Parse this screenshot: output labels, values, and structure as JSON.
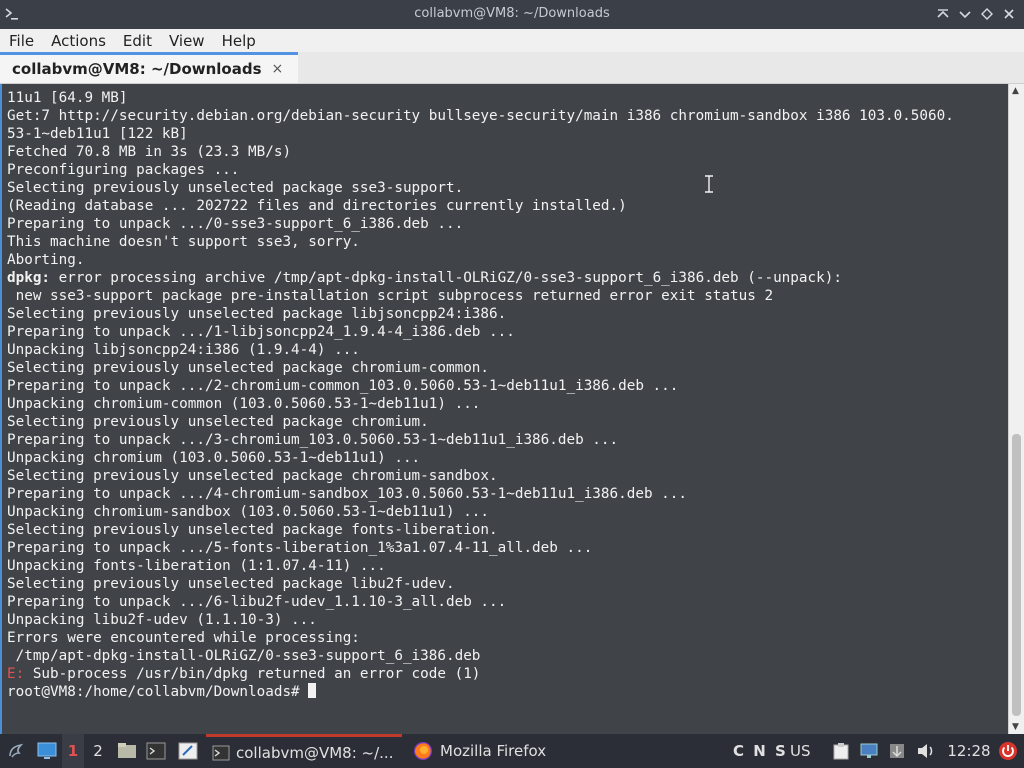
{
  "window": {
    "title": "collabvm@VM8: ~/Downloads",
    "controls": [
      "maximize-icon",
      "minimize-icon",
      "sticky-icon",
      "close-icon"
    ]
  },
  "menu": [
    "File",
    "Actions",
    "Edit",
    "View",
    "Help"
  ],
  "tab": {
    "label": "collabvm@VM8: ~/Downloads",
    "close": "×"
  },
  "terminal": {
    "lines": [
      {
        "t": "11u1 [64.9 MB]"
      },
      {
        "t": "Get:7 http://security.debian.org/debian-security bullseye-security/main i386 chromium-sandbox i386 103.0.5060."
      },
      {
        "t": "53-1~deb11u1 [122 kB]"
      },
      {
        "t": "Fetched 70.8 MB in 3s (23.3 MB/s)"
      },
      {
        "t": "Preconfiguring packages ..."
      },
      {
        "t": "Selecting previously unselected package sse3-support."
      },
      {
        "t": "(Reading database ... 202722 files and directories currently installed.)"
      },
      {
        "t": "Preparing to unpack .../0-sse3-support_6_i386.deb ..."
      },
      {
        "t": "This machine doesn't support sse3, sorry."
      },
      {
        "t": "Aborting."
      },
      {
        "b": "dpkg:",
        "t": " error processing archive /tmp/apt-dpkg-install-OLRiGZ/0-sse3-support_6_i386.deb (--unpack):"
      },
      {
        "t": " new sse3-support package pre-installation script subprocess returned error exit status 2"
      },
      {
        "t": "Selecting previously unselected package libjsoncpp24:i386."
      },
      {
        "t": "Preparing to unpack .../1-libjsoncpp24_1.9.4-4_i386.deb ..."
      },
      {
        "t": "Unpacking libjsoncpp24:i386 (1.9.4-4) ..."
      },
      {
        "t": "Selecting previously unselected package chromium-common."
      },
      {
        "t": "Preparing to unpack .../2-chromium-common_103.0.5060.53-1~deb11u1_i386.deb ..."
      },
      {
        "t": "Unpacking chromium-common (103.0.5060.53-1~deb11u1) ..."
      },
      {
        "t": "Selecting previously unselected package chromium."
      },
      {
        "t": "Preparing to unpack .../3-chromium_103.0.5060.53-1~deb11u1_i386.deb ..."
      },
      {
        "t": "Unpacking chromium (103.0.5060.53-1~deb11u1) ..."
      },
      {
        "t": "Selecting previously unselected package chromium-sandbox."
      },
      {
        "t": "Preparing to unpack .../4-chromium-sandbox_103.0.5060.53-1~deb11u1_i386.deb ..."
      },
      {
        "t": "Unpacking chromium-sandbox (103.0.5060.53-1~deb11u1) ..."
      },
      {
        "t": "Selecting previously unselected package fonts-liberation."
      },
      {
        "t": "Preparing to unpack .../5-fonts-liberation_1%3a1.07.4-11_all.deb ..."
      },
      {
        "t": "Unpacking fonts-liberation (1:1.07.4-11) ..."
      },
      {
        "t": "Selecting previously unselected package libu2f-udev."
      },
      {
        "t": "Preparing to unpack .../6-libu2f-udev_1.1.10-3_all.deb ..."
      },
      {
        "t": "Unpacking libu2f-udev (1.1.10-3) ..."
      },
      {
        "t": "Errors were encountered while processing:"
      },
      {
        "t": " /tmp/apt-dpkg-install-OLRiGZ/0-sse3-support_6_i386.deb"
      },
      {
        "r": "E:",
        "t": " Sub-process /usr/bin/dpkg returned an error code (1)"
      },
      {
        "t": "root@VM8:/home/collabvm/Downloads# ",
        "cursor": true
      }
    ]
  },
  "taskbar": {
    "workspaces": [
      "1",
      "2"
    ],
    "tasks": [
      {
        "label": "collabvm@VM8: ~/...",
        "icon": "terminal-icon",
        "active": true
      },
      {
        "label": "Mozilla Firefox",
        "icon": "firefox-icon",
        "active": false
      }
    ],
    "keyboard_indicators": "C N S",
    "layout": "US",
    "clock": "12:28"
  },
  "colors": {
    "accent": "#5294e2",
    "terminal_bg": "#404448",
    "error_red": "#e05252"
  }
}
